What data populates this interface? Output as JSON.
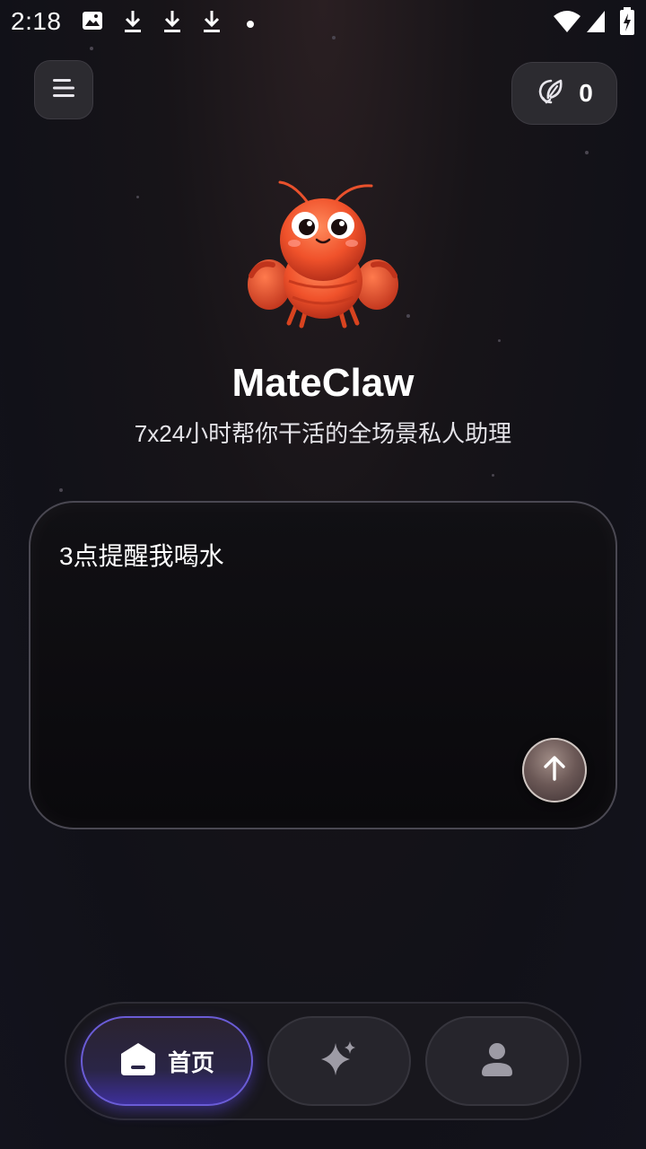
{
  "status_bar": {
    "time": "2:18",
    "left_icons": [
      "image-icon",
      "download-icon",
      "download-icon",
      "download-icon",
      "dot-icon"
    ],
    "right_icons": [
      "wifi-icon",
      "signal-icon",
      "battery-charging-icon"
    ]
  },
  "header": {
    "menu_icon": "menu-icon",
    "credit_icon": "leaf-coin-icon",
    "credit_count": "0"
  },
  "hero": {
    "title": "MateClaw",
    "subtitle": "7x24小时帮你干活的全场景私人助理"
  },
  "input": {
    "text": "3点提醒我喝水",
    "send_icon": "arrow-up-icon"
  },
  "bottom_nav": {
    "items": [
      {
        "label": "首页",
        "icon": "home-icon",
        "active": true
      },
      {
        "label": "",
        "icon": "sparkle-icon",
        "active": false
      },
      {
        "label": "",
        "icon": "person-icon",
        "active": false
      }
    ]
  },
  "colors": {
    "accent": "#6a5cd6",
    "background": "#141318",
    "card_border": "#4a4852"
  }
}
